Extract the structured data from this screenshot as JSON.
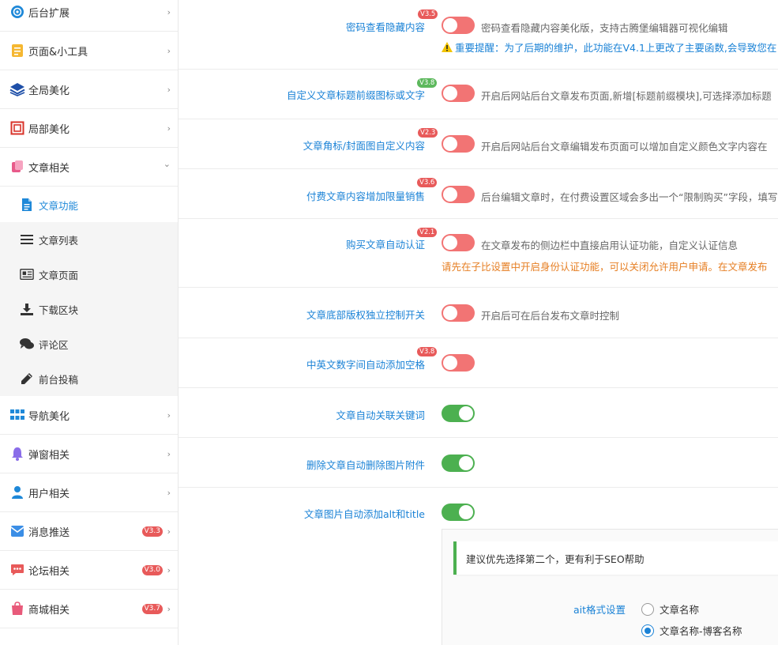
{
  "sidebar": {
    "items": [
      {
        "label": "后台扩展",
        "icon": "gear-icon"
      },
      {
        "label": "页面&小工具",
        "icon": "page-icon"
      },
      {
        "label": "全局美化",
        "icon": "layers-icon"
      },
      {
        "label": "局部美化",
        "icon": "frame-icon"
      },
      {
        "label": "文章相关",
        "icon": "article-icon"
      },
      {
        "label": "导航美化",
        "icon": "grid-icon"
      },
      {
        "label": "弹窗相关",
        "icon": "bell-icon"
      },
      {
        "label": "用户相关",
        "icon": "user-icon"
      },
      {
        "label": "消息推送",
        "icon": "message-icon",
        "badge": "V3.3"
      },
      {
        "label": "论坛相关",
        "icon": "chat-icon",
        "badge": "V3.0"
      },
      {
        "label": "商城相关",
        "icon": "bag-icon",
        "badge": "V3.7"
      }
    ],
    "subitems": [
      {
        "label": "文章功能",
        "icon": "document-icon",
        "active": true
      },
      {
        "label": "文章列表",
        "icon": "list-icon"
      },
      {
        "label": "文章页面",
        "icon": "newspaper-icon"
      },
      {
        "label": "下载区块",
        "icon": "download-icon"
      },
      {
        "label": "评论区",
        "icon": "comments-icon"
      },
      {
        "label": "前台投稿",
        "icon": "pencil-icon"
      }
    ],
    "arrows": {
      "right": "›",
      "down": "⌄"
    }
  },
  "settings": [
    {
      "label": "密码查看隐藏内容",
      "badge": "V3.5",
      "badge_color": "#e85a5a",
      "state": "off",
      "desc": "密码查看隐藏内容美化版，支持古腾堡编辑器可视化编辑",
      "note": "重要提醒：为了后期的维护，此功能在V4.1上更改了主要函数,会导致您在",
      "note_icon": "warning-icon"
    },
    {
      "label": "自定义文章标题前缀图标或文字",
      "badge": "V3.8",
      "badge_color": "#5cb85c",
      "state": "off",
      "desc": "开启后网站后台文章发布页面,新增[标题前缀模块],可选择添加标题"
    },
    {
      "label": "文章角标/封面图自定义内容",
      "badge": "V2.3",
      "badge_color": "#e85a5a",
      "state": "off",
      "desc": "开启后网站后台文章编辑发布页面可以增加自定义颜色文字内容在"
    },
    {
      "label": "付费文章内容增加限量销售",
      "badge": "V3.6",
      "badge_color": "#e85a5a",
      "state": "off",
      "desc": "后台编辑文章时，在付费设置区域会多出一个“限制购买”字段，填写"
    },
    {
      "label": "购买文章自动认证",
      "badge": "V2.1",
      "badge_color": "#e85a5a",
      "state": "off",
      "desc": "在文章发布的侧边栏中直接启用认证功能，自定义认证信息",
      "note": "请先在子比设置中开启身份认证功能，可以关闭允许用户申请。在文章发布"
    },
    {
      "label": "文章底部版权独立控制开关",
      "state": "off",
      "desc": "开启后可在后台发布文章时控制"
    },
    {
      "label": "中英文数字间自动添加空格",
      "badge": "V3.8",
      "badge_color": "#e85a5a",
      "state": "off",
      "desc": ""
    },
    {
      "label": "文章自动关联关键词",
      "state": "on",
      "desc": ""
    },
    {
      "label": "删除文章自动删除图片附件",
      "state": "on",
      "desc": ""
    },
    {
      "label": "文章图片自动添加alt和title",
      "state": "on",
      "desc": ""
    }
  ],
  "subpanel": {
    "tip": "建议优先选择第二个，更有利于SEO帮助",
    "alt_label": "ait格式设置",
    "options": [
      {
        "label": "文章名称",
        "checked": false
      },
      {
        "label": "文章名称-博客名称",
        "checked": true
      }
    ]
  },
  "colors": {
    "accent": "#1a82d6",
    "toggle_off": "#f27474",
    "toggle_on": "#4cb050"
  }
}
